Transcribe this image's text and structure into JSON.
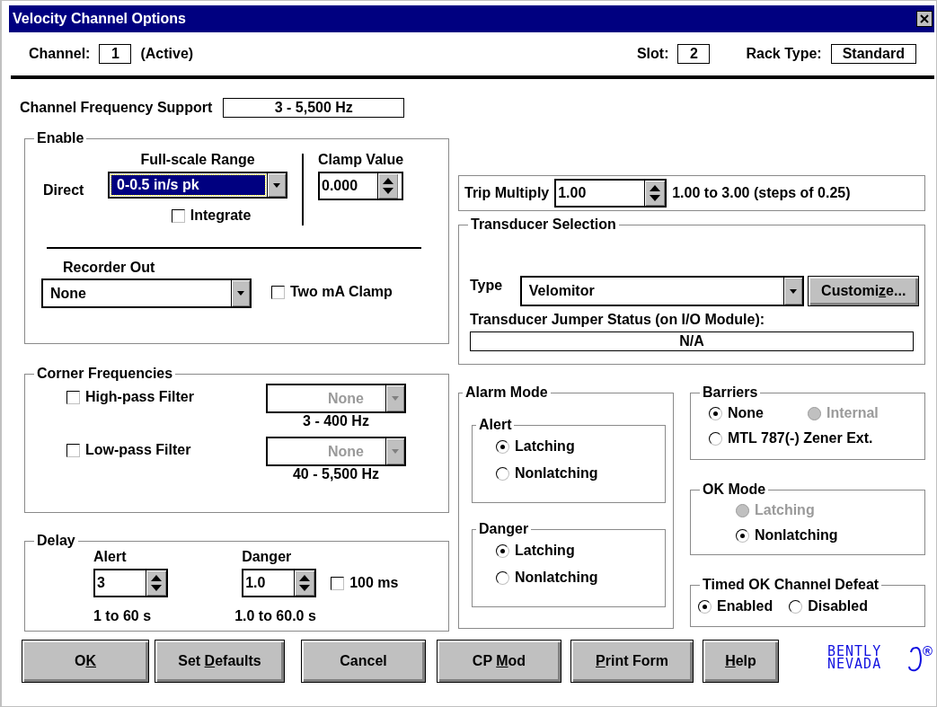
{
  "window": {
    "title": "Velocity Channel Options"
  },
  "header": {
    "channel_label": "Channel:",
    "channel": "1",
    "channel_status": "(Active)",
    "slot_label": "Slot:",
    "slot": "2",
    "rack_type_label": "Rack Type:",
    "rack_type": "Standard"
  },
  "frequency_support": {
    "label": "Channel Frequency Support",
    "value": "3 - 5,500 Hz"
  },
  "enable": {
    "title": "Enable",
    "direct_label": "Direct",
    "full_scale_label": "Full-scale Range",
    "full_scale_value": "0-0.5 in/s pk",
    "full_scale_focused": true,
    "clamp_label": "Clamp Value",
    "clamp_value": "0.000",
    "integrate": {
      "label": "Integrate",
      "checked": false
    },
    "recorder_label": "Recorder Out",
    "recorder_value": "None",
    "two_ma_clamp": {
      "label": "Two mA Clamp",
      "checked": false
    }
  },
  "corner_frequencies": {
    "title": "Corner Frequencies",
    "filters": [
      {
        "label": "High-pass Filter",
        "checked": false,
        "value": "None",
        "disabled": true,
        "range": "3 - 400 Hz"
      },
      {
        "label": "Low-pass Filter",
        "checked": false,
        "value": "None",
        "disabled": true,
        "range": "40 - 5,500 Hz"
      }
    ]
  },
  "delay": {
    "title": "Delay",
    "alert_label": "Alert",
    "alert_value": "3",
    "alert_range": "1 to 60 s",
    "danger_label": "Danger",
    "danger_value": "1.0",
    "danger_range": "1.0 to 60.0 s",
    "hundred_ms": {
      "label": "100 ms",
      "checked": false
    }
  },
  "trip_multiply": {
    "label": "Trip Multiply",
    "value": "1.00",
    "range": "1.00 to 3.00 (steps of 0.25)"
  },
  "transducer": {
    "title": "Transducer Selection",
    "type_label": "Type",
    "type_value": "Velomitor",
    "customize": {
      "label_before": "Customi",
      "mnemonic": "z",
      "label_after": "e..."
    },
    "jumper_label": "Transducer Jumper Status (on I/O Module):",
    "jumper_value": "N/A"
  },
  "alarm_mode": {
    "title": "Alarm Mode",
    "groups": [
      {
        "title": "Alert",
        "options": [
          {
            "label": "Latching",
            "selected": true,
            "disabled": false
          },
          {
            "label": "Nonlatching",
            "selected": false,
            "disabled": false
          }
        ]
      },
      {
        "title": "Danger",
        "options": [
          {
            "label": "Latching",
            "selected": true,
            "disabled": false
          },
          {
            "label": "Nonlatching",
            "selected": false,
            "disabled": false
          }
        ]
      }
    ]
  },
  "barriers": {
    "title": "Barriers",
    "options": [
      {
        "label": "None",
        "selected": true,
        "disabled": false
      },
      {
        "label": "Internal",
        "selected": false,
        "disabled": true
      },
      {
        "label": "MTL 787(-) Zener Ext.",
        "selected": false,
        "disabled": false
      }
    ]
  },
  "ok_mode": {
    "title": "OK Mode",
    "options": [
      {
        "label": "Latching",
        "selected": false,
        "disabled": true
      },
      {
        "label": "Nonlatching",
        "selected": true,
        "disabled": false
      }
    ]
  },
  "timed_ok": {
    "title": "Timed OK Channel Defeat",
    "options": [
      {
        "label": "Enabled",
        "selected": true,
        "disabled": false
      },
      {
        "label": "Disabled",
        "selected": false,
        "disabled": false
      }
    ]
  },
  "buttons": [
    {
      "label_before": "O",
      "mnemonic": "K"
    },
    {
      "label_before": "Set ",
      "mnemonic": "D",
      "label_after": "efaults"
    },
    {
      "label_before": "Cancel"
    },
    {
      "label_before": "CP ",
      "mnemonic": "M",
      "label_after": "od"
    },
    {
      "mnemonic": "P",
      "label_after": "rint Form"
    },
    {
      "mnemonic": "H",
      "label_after": "elp"
    }
  ],
  "logo": {
    "wordmark": "BENTLY NEVADA",
    "registered": "®"
  }
}
